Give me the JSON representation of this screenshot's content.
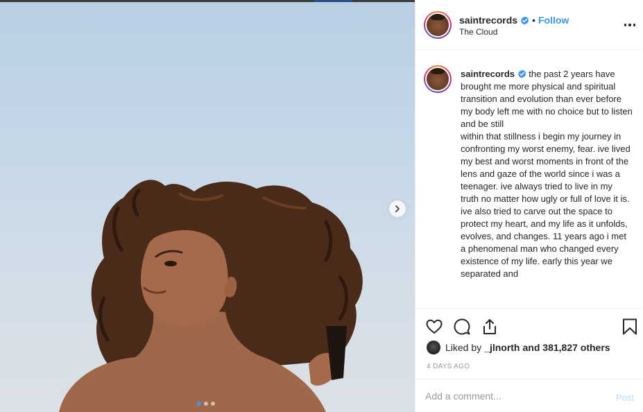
{
  "post": {
    "username": "saintrecords",
    "follow_separator": "•",
    "follow_label": "Follow",
    "location": "The Cloud",
    "caption_text": "the past 2 years have brought me more physical and spiritual transition and evolution than ever before\nmy body left me with no choice but to listen and be still\nwithin that stillness i begin my journey in confronting my worst enemy, fear. ive lived my best and worst moments in front of the lens and gaze of the world since i was a teenager. ive always tried to live in my truth no matter how ugly or full of love it is. ive also tried to carve out the space to protect my heart, and my life as it unfolds, evolves, and changes. 11 years ago i met a phenomenal man who changed every existence of my life. early this year we separated and",
    "likes_prefix": "Liked by",
    "liked_by_user": "_jlnorth",
    "likes_suffix": "and 381,827 others",
    "timestamp": "4 DAYS AGO",
    "comment_placeholder": "Add a comment...",
    "post_label": "Post"
  },
  "carousel": {
    "slide_count": 3,
    "active_index": 0
  },
  "icons": {
    "verified": "verified-badge-icon",
    "more": "more-options-icon",
    "next": "chevron-right-icon",
    "like": "heart-icon",
    "comment": "comment-bubble-icon",
    "share": "share-icon",
    "save": "bookmark-icon"
  },
  "colors": {
    "accent": "#3897f0",
    "post_disabled": "#b2dffc",
    "muted": "#999999"
  }
}
